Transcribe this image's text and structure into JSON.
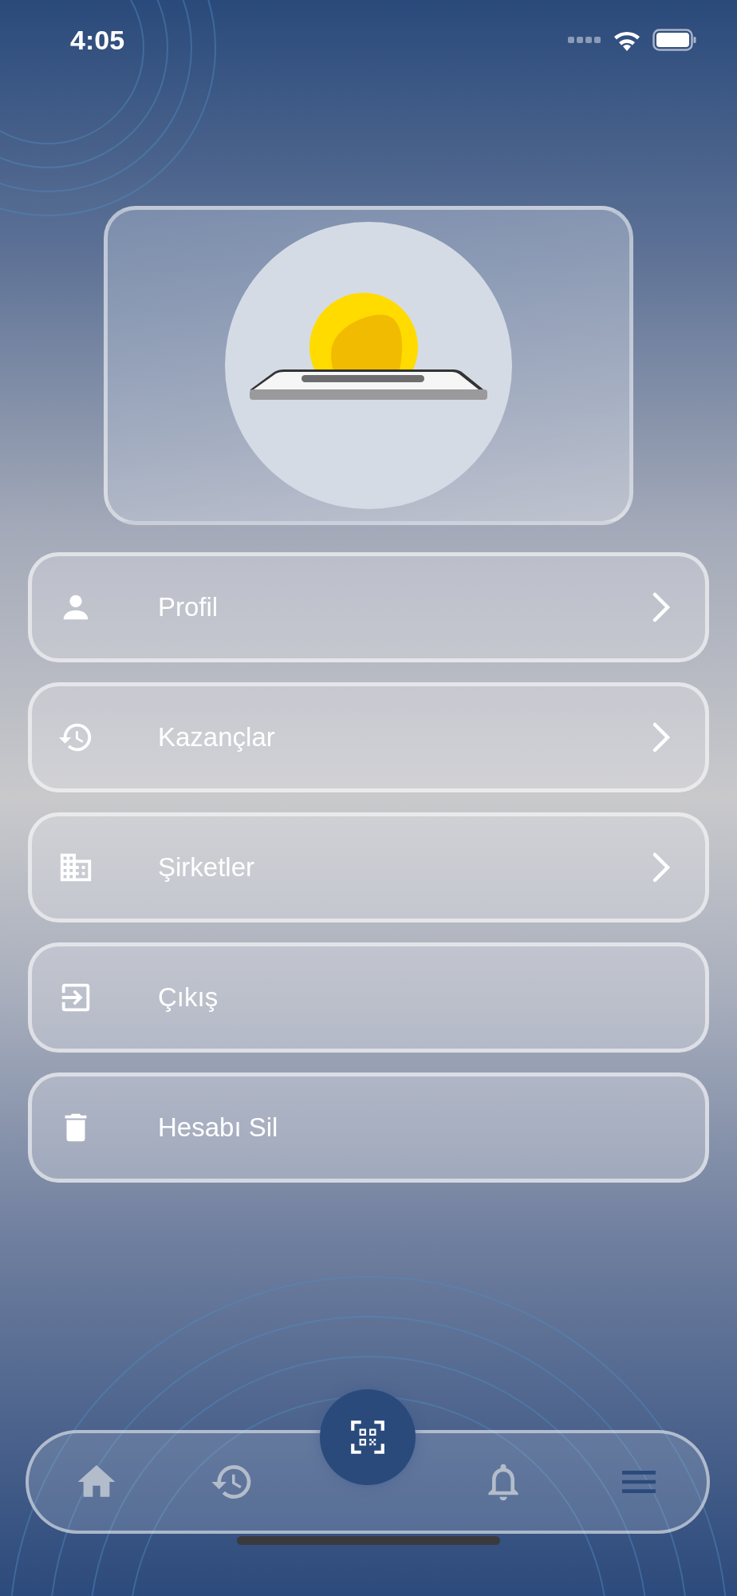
{
  "status_bar": {
    "time": "4:05"
  },
  "menu": [
    {
      "label": "Profil",
      "kind": "person",
      "chevron": true
    },
    {
      "label": "Kazançlar",
      "kind": "history",
      "chevron": true
    },
    {
      "label": "Şirketler",
      "kind": "building",
      "chevron": true
    },
    {
      "label": "Çıkış",
      "kind": "exit",
      "chevron": false
    },
    {
      "label": "Hesabı Sil",
      "kind": "trash",
      "chevron": false
    }
  ],
  "tab_bar": [
    {
      "kind": "home",
      "selected": false
    },
    {
      "kind": "history",
      "selected": false
    },
    {
      "kind": "qr",
      "selected": false
    },
    {
      "kind": "bell",
      "selected": false
    },
    {
      "kind": "menu",
      "selected": true
    }
  ]
}
